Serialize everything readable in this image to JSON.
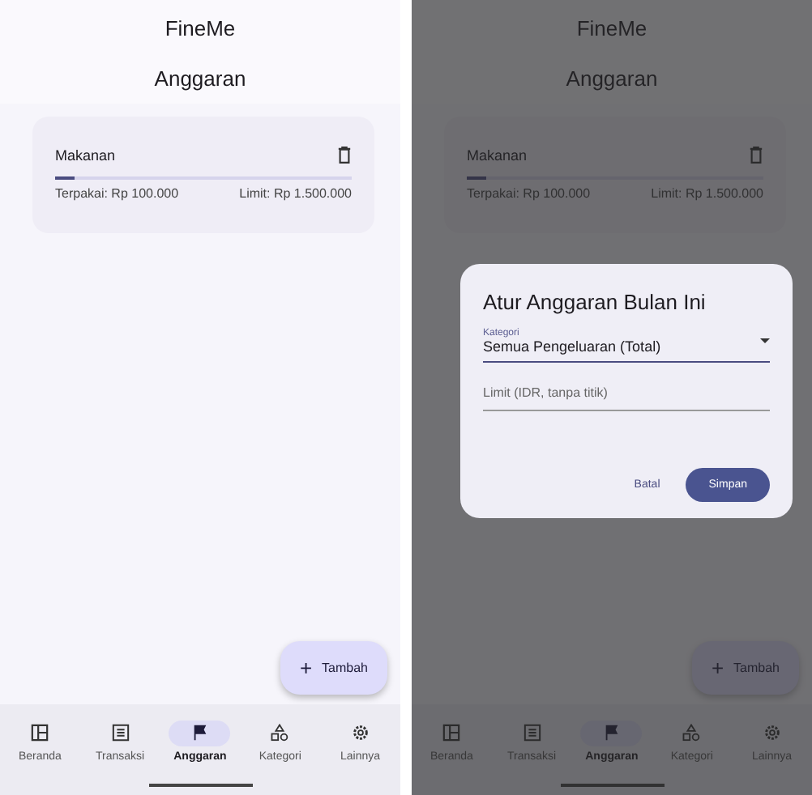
{
  "screens": [
    {
      "app_title": "FineMe",
      "page_title": "Anggaran",
      "budgets": [
        {
          "name": "Makanan",
          "level": 0.067,
          "spent": "Terpakai: Rp 100.000",
          "limit": "Limit: Rp 1.500.000"
        }
      ],
      "fab": {
        "icon": "+",
        "label": "Tambah"
      },
      "nav": [
        {
          "kind": "home",
          "label": "Beranda",
          "selected": false
        },
        {
          "kind": "list",
          "label": "Transaksi",
          "selected": false
        },
        {
          "kind": "flag",
          "label": "Anggaran",
          "selected": true
        },
        {
          "kind": "shapes",
          "label": "Kategori",
          "selected": false
        },
        {
          "kind": "gear",
          "label": "Lainnya",
          "selected": false
        }
      ]
    },
    {
      "app_title": "FineMe",
      "page_title": "Anggaran",
      "budgets": [
        {
          "name": "Makanan",
          "level": 0.067,
          "spent": "Terpakai: Rp 100.000",
          "limit": "Limit: Rp 1.500.000"
        }
      ],
      "fab": {
        "icon": "+",
        "label": "Tambah"
      },
      "nav": [
        {
          "kind": "home",
          "label": "Beranda",
          "selected": false
        },
        {
          "kind": "list",
          "label": "Transaksi",
          "selected": false
        },
        {
          "kind": "flag",
          "label": "Anggaran",
          "selected": true
        },
        {
          "kind": "shapes",
          "label": "Kategori",
          "selected": false
        },
        {
          "kind": "gear",
          "label": "Lainnya",
          "selected": false
        }
      ],
      "dialog": {
        "title": "Atur Anggaran Bulan Ini",
        "category_label": "Kategori",
        "category_value": "Semua Pengeluaran (Total)",
        "limit_placeholder": "Limit (IDR, tanpa titik)",
        "buttons": [
          {
            "kind": "text",
            "label": "Batal"
          },
          {
            "kind": "filled",
            "label": "Simpan"
          }
        ]
      }
    }
  ]
}
